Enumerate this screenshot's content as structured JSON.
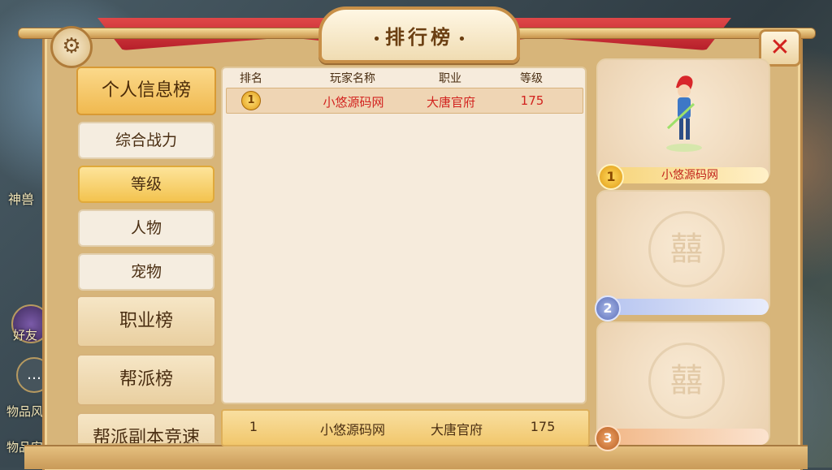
{
  "window": {
    "title": "排行榜"
  },
  "background": {
    "left_texts": [
      "神兽",
      "物品风",
      "物品安"
    ],
    "friend_label": "好友"
  },
  "tabs": [
    {
      "label": "个人信息榜",
      "type": "major",
      "active": true
    },
    {
      "label": "综合战力",
      "type": "minor",
      "active": false
    },
    {
      "label": "等级",
      "type": "minor",
      "active": true
    },
    {
      "label": "人物",
      "type": "minor",
      "active": false
    },
    {
      "label": "宠物",
      "type": "minor",
      "active": false
    },
    {
      "label": "职业榜",
      "type": "major",
      "active": false
    },
    {
      "label": "帮派榜",
      "type": "major",
      "active": false
    },
    {
      "label": "帮派副本竞速",
      "type": "major",
      "active": false
    }
  ],
  "table": {
    "headers": {
      "rank": "排名",
      "name": "玩家名称",
      "job": "职业",
      "level": "等级"
    },
    "rows": [
      {
        "rank": "1",
        "name": "小悠源码网",
        "job": "大唐官府",
        "level": "175"
      }
    ]
  },
  "my_rank": {
    "rank": "1",
    "name": "小悠源码网",
    "job": "大唐官府",
    "level": "175"
  },
  "podium": [
    {
      "place": "1",
      "name": "小悠源码网"
    },
    {
      "place": "2",
      "name": ""
    },
    {
      "place": "3",
      "name": ""
    }
  ],
  "icons": {
    "settings": "gear-icon",
    "close": "close-icon",
    "emblem": "xi-emblem-icon"
  },
  "colors": {
    "accent_red": "#d2231f",
    "gold": "#f0b94f"
  }
}
